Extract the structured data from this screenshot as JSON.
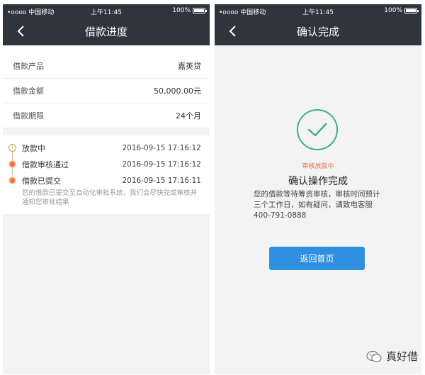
{
  "left": {
    "status": {
      "carrier": "•oooo 中国移动",
      "time": "上午11:45",
      "battery": "100%"
    },
    "title": "借款进度",
    "info": [
      {
        "label": "借款产品",
        "value": "嘉英贷"
      },
      {
        "label": "借款金额",
        "value": "50,000.00元"
      },
      {
        "label": "借款期限",
        "value": "24个月"
      }
    ],
    "timeline": [
      {
        "label": "放款中",
        "time": "2016-09-15 17:16:12"
      },
      {
        "label": "借款审核通过",
        "time": "2016-09-15 17:16:12"
      },
      {
        "label": "借款已提交",
        "time": "2016-09-15 17:16:11"
      }
    ],
    "timeline_desc": "您的借款已提交至自动化审批系统，我们会尽快完成审核并通知您审批结果"
  },
  "right": {
    "status": {
      "carrier": "•oooo 中国移动",
      "time": "上午11:45",
      "battery": "100%"
    },
    "title": "确认完成",
    "audit_status": "审核放款中",
    "done_title": "确认操作完成",
    "done_message": "您的借款等待筹资审核，审核时间预计三个工作日，如有疑问，请致电客服400-791-0888",
    "home_button": "返回首页"
  },
  "brand": "真好借",
  "colors": {
    "nav_bg": "#2f343d",
    "accent_orange": "#e8743a",
    "success_green": "#3fab8b",
    "button_blue": "#2f8fe0"
  },
  "icons": [
    "back-arrow-icon",
    "wifi-icon",
    "battery-icon",
    "check-icon",
    "timeline-dot-icon",
    "wechat-icon"
  ]
}
